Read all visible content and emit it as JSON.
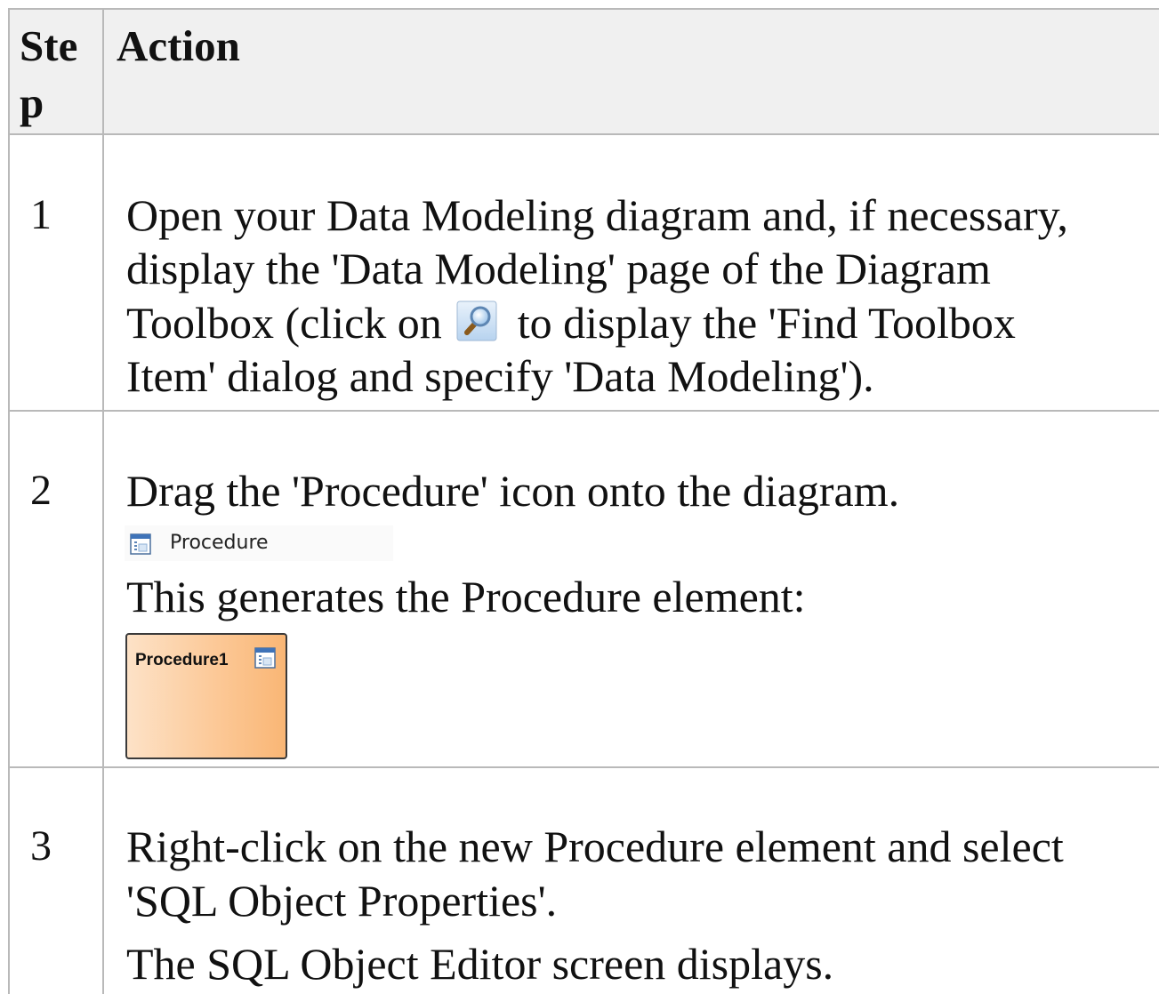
{
  "table": {
    "header": {
      "step_line1": "Ste",
      "step_line2": "p",
      "action": "Action"
    },
    "rows": [
      {
        "number": "1",
        "lines": [
          "Open your Data Modeling diagram and, if necessary,",
          "display the 'Data Modeling' page of the Diagram",
          "Toolbox (click on",
          "to display the 'Find Toolbox",
          "Item' dialog and specify 'Data Modeling')."
        ],
        "inline_icon": "search-icon"
      },
      {
        "number": "2",
        "lines": [
          "Drag the 'Procedure' icon onto the diagram.",
          "This generates the Procedure element:"
        ],
        "toolbox_item": {
          "label": "Procedure",
          "icon": "procedure-icon"
        },
        "element": {
          "name": "Procedure1",
          "icon": "procedure-icon",
          "fill_colors": [
            "#fde2c7",
            "#f9b675"
          ]
        }
      },
      {
        "number": "3",
        "lines": [
          "Right-click on the new Procedure element and select",
          "'SQL Object Properties'.",
          "The SQL Object Editor screen displays."
        ]
      }
    ]
  },
  "colors": {
    "header_background": "#f0f0f0",
    "grid_line": "#b9b9b9"
  }
}
